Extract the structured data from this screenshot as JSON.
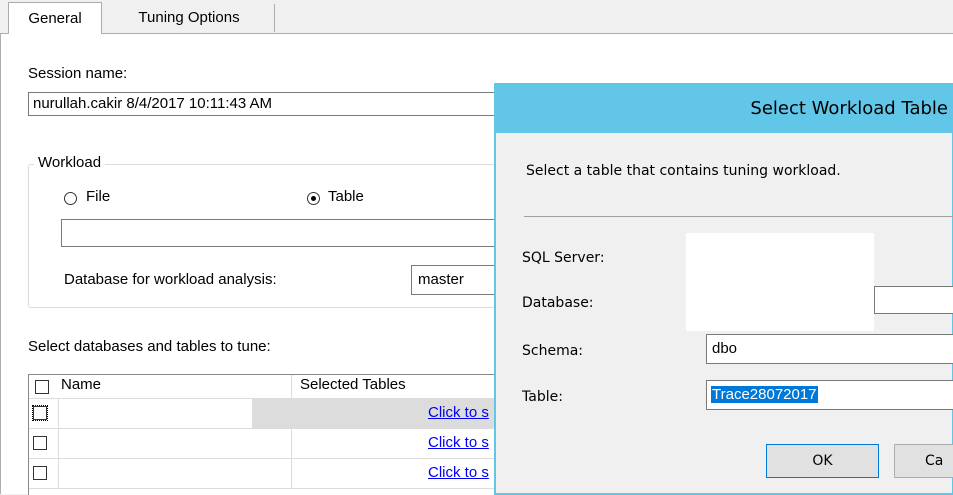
{
  "tabs": [
    {
      "label": "General",
      "active": true
    },
    {
      "label": "Tuning Options",
      "active": false
    }
  ],
  "general": {
    "session_label": "Session name:",
    "session_value": "nurullah.cakir 8/4/2017 10:11:43 AM",
    "workload": {
      "legend": "Workload",
      "file_label": "File",
      "table_label": "Table",
      "selected": "Table",
      "path_value": "",
      "db_label": "Database for workload analysis:",
      "db_value": "master"
    },
    "tune_label": "Select databases and tables to tune:",
    "grid": {
      "columns": [
        "Name",
        "Selected Tables"
      ],
      "rows": [
        {
          "name": "",
          "selected": "Click to s"
        },
        {
          "name": "",
          "selected": "Click to s"
        },
        {
          "name": "",
          "selected": "Click to s"
        }
      ]
    }
  },
  "dialog": {
    "title": "Select Workload Table",
    "instruction": "Select a table that contains tuning workload.",
    "sql_server_label": "SQL Server:",
    "sql_server_value": "",
    "database_label": "Database:",
    "database_value": "",
    "schema_label": "Schema:",
    "schema_value": "dbo",
    "table_label": "Table:",
    "table_value": "Trace28072017",
    "ok_label": "OK",
    "cancel_label": "Ca"
  },
  "colors": {
    "dialog_accent": "#61c6e8",
    "selection": "#0078d7",
    "link": "#0000ee"
  }
}
